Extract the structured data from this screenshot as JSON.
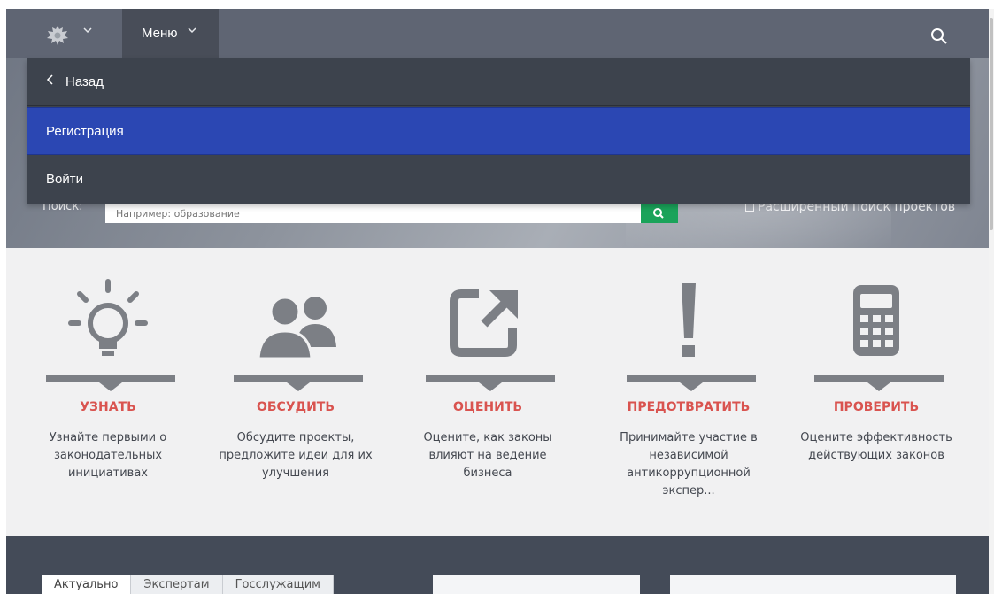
{
  "header": {
    "menu_label": "Меню",
    "chevron": "⌵"
  },
  "dropdown": {
    "back_label": "Назад",
    "items": [
      {
        "label": "Регистрация"
      },
      {
        "label": "Войти"
      }
    ]
  },
  "search": {
    "label": "Поиск:",
    "placeholder": "Например: образование",
    "advanced_label": "Расширенный поиск проектов"
  },
  "features": [
    {
      "title": "УЗНАТЬ",
      "desc": "Узнайте первыми о законодательных инициативах",
      "icon": "lightbulb-icon"
    },
    {
      "title": "ОБСУДИТЬ",
      "desc": "Обсудите проекты, предложите идеи для их улучшения",
      "icon": "people-icon"
    },
    {
      "title": "ОЦЕНИТЬ",
      "desc": "Оцените, как законы влияют на ведение бизнеса",
      "icon": "share-arrow-icon"
    },
    {
      "title": "ПРЕДОТВРАТИТЬ",
      "desc": "Принимайте участие в независимой антикоррупционной экспер...",
      "icon": "exclamation-icon"
    },
    {
      "title": "ПРОВЕРИТЬ",
      "desc": "Оцените эффективность действующих законов",
      "icon": "calculator-icon"
    }
  ],
  "bottom_tabs": [
    {
      "label": "Актуально"
    },
    {
      "label": "Экспертам"
    },
    {
      "label": "Госслужащим"
    }
  ],
  "colors": {
    "accent_blue": "#2b47b3",
    "feature_title": "#d9534f",
    "search_button": "#1aa35a",
    "topbar": "#5f6573"
  }
}
